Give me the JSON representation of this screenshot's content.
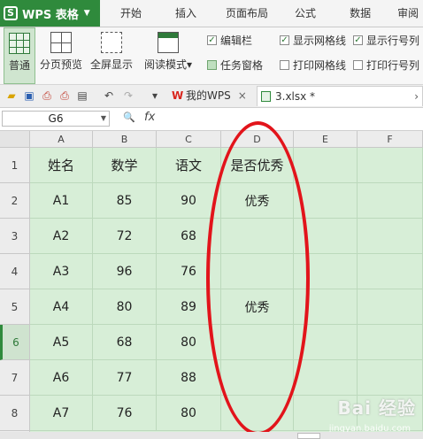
{
  "app": {
    "name": "WPS 表格",
    "logo_letter": "S"
  },
  "menu_tabs": [
    "开始",
    "插入",
    "页面布局",
    "公式",
    "数据",
    "审阅"
  ],
  "ribbon": {
    "view_buttons": [
      {
        "label": "普通",
        "active": true
      },
      {
        "label": "分页预览",
        "active": false
      },
      {
        "label": "全屏显示",
        "active": false
      },
      {
        "label": "阅读模式",
        "active": false
      }
    ],
    "read_mode_caret": "▾",
    "checks": [
      {
        "label": "编辑栏",
        "checked": true
      },
      {
        "label": "任务窗格",
        "checked": false
      },
      {
        "label": "显示网格线",
        "checked": true
      },
      {
        "label": "打印网格线",
        "checked": false
      },
      {
        "label": "显示行号列",
        "checked": true
      },
      {
        "label": "打印行号列",
        "checked": false
      }
    ]
  },
  "doc_tabs": [
    {
      "label": "我的WPS",
      "icon": "W",
      "active": false
    },
    {
      "label": "3.xlsx *",
      "active": true
    }
  ],
  "tab_scroll_arrow": "›",
  "formula_bar": {
    "cell_ref": "G6",
    "fx_label": "fx",
    "zoom_icon": "🔍"
  },
  "sheet": {
    "columns": [
      "A",
      "B",
      "C",
      "D",
      "E",
      "F"
    ],
    "rows": [
      "1",
      "2",
      "3",
      "4",
      "5",
      "6",
      "7",
      "8"
    ],
    "selected_row": "6",
    "cells": [
      [
        "姓名",
        "数学",
        "语文",
        "是否优秀",
        "",
        ""
      ],
      [
        "A1",
        "85",
        "90",
        "优秀",
        "",
        ""
      ],
      [
        "A2",
        "72",
        "68",
        "",
        "",
        ""
      ],
      [
        "A3",
        "96",
        "76",
        "",
        "",
        ""
      ],
      [
        "A4",
        "80",
        "89",
        "优秀",
        "",
        ""
      ],
      [
        "A5",
        "68",
        "80",
        "",
        "",
        ""
      ],
      [
        "A6",
        "77",
        "88",
        "",
        "",
        ""
      ],
      [
        "A7",
        "76",
        "80",
        "",
        "",
        ""
      ]
    ]
  },
  "watermark": {
    "main": "Bai 经验",
    "sub": "jingyan.baidu.com"
  },
  "colors": {
    "brand": "#2f8a3c",
    "grid_bg": "#d7eed7",
    "highlight": "#e2141b"
  }
}
